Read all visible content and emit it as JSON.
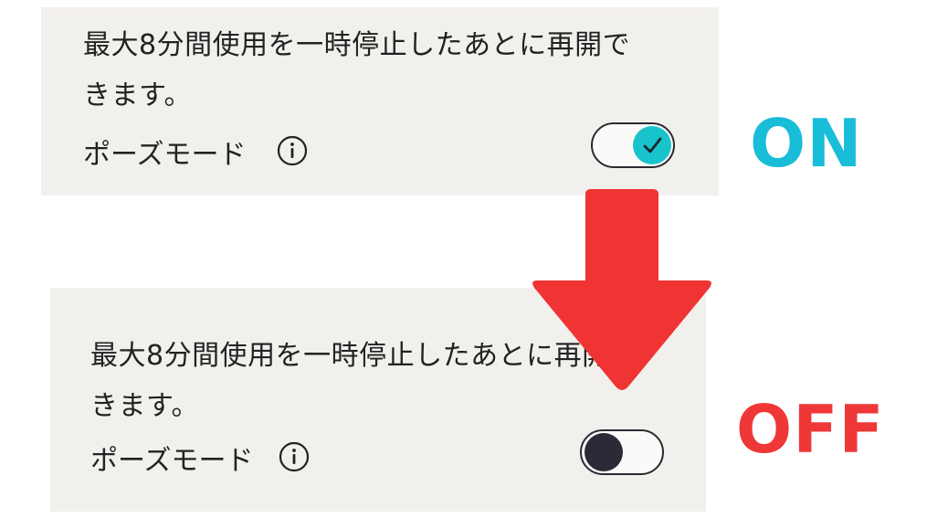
{
  "panels": [
    {
      "description_line1": "最大8分間使用を一時停止したあとに再開で",
      "description_line2": "きます。",
      "setting_label": "ポーズモード",
      "toggle_state": "on"
    },
    {
      "description_line1": "最大8分間使用を一時停止したあとに再開で",
      "description_line2": "きます。",
      "setting_label": "ポーズモード",
      "toggle_state": "off"
    }
  ],
  "state_labels": {
    "on": "ON",
    "off": "OFF"
  },
  "colors": {
    "on_label": "#18bdd8",
    "off_label": "#ef3737",
    "toggle_on_knob": "#19c3cc",
    "toggle_off_knob": "#2b2a36",
    "arrow": "#f03434",
    "panel_bg": "#f2f0ed"
  },
  "icons": {
    "info": "info-icon",
    "check": "checkmark-icon",
    "arrow": "down-arrow-icon"
  }
}
